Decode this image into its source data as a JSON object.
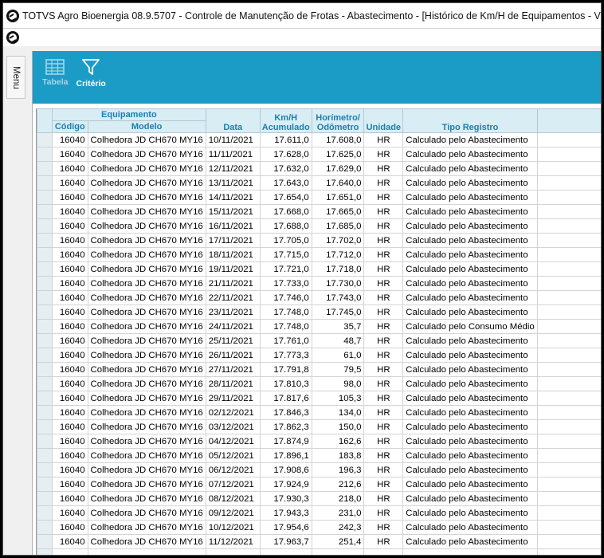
{
  "window": {
    "title": "TOTVS Agro Bioenergia 08.9.5707 - Controle de Manutenção de Frotas - Abastecimento - [Histórico de Km/H de Equipamentos - Vida ]"
  },
  "sidebar": {
    "menu_label": "Menu"
  },
  "ribbon": {
    "tabela_label": "Tabela",
    "criterio_label": "Critério",
    "accent": "#1b9cc7"
  },
  "grid": {
    "group_header": "Equipamento",
    "headers": {
      "codigo": "Código",
      "modelo": "Modelo",
      "data": "Data",
      "km_line1": "Km/H",
      "km_line2": "Acumulado",
      "hor_line1": "Horímetro/",
      "hor_line2": "Odômetro",
      "unidade": "Unidade",
      "tipo": "Tipo Registro"
    },
    "rows": [
      {
        "codigo": "16040",
        "modelo": "Colhedora JD CH670 MY16",
        "data": "10/11/2021",
        "km": "17.611,0",
        "hor": "17.608,0",
        "unidade": "HR",
        "tipo": "Calculado pelo Abastecimento"
      },
      {
        "codigo": "16040",
        "modelo": "Colhedora JD CH670 MY16",
        "data": "11/11/2021",
        "km": "17.628,0",
        "hor": "17.625,0",
        "unidade": "HR",
        "tipo": "Calculado pelo Abastecimento"
      },
      {
        "codigo": "16040",
        "modelo": "Colhedora JD CH670 MY16",
        "data": "12/11/2021",
        "km": "17.632,0",
        "hor": "17.629,0",
        "unidade": "HR",
        "tipo": "Calculado pelo Abastecimento"
      },
      {
        "codigo": "16040",
        "modelo": "Colhedora JD CH670 MY16",
        "data": "13/11/2021",
        "km": "17.643,0",
        "hor": "17.640,0",
        "unidade": "HR",
        "tipo": "Calculado pelo Abastecimento"
      },
      {
        "codigo": "16040",
        "modelo": "Colhedora JD CH670 MY16",
        "data": "14/11/2021",
        "km": "17.654,0",
        "hor": "17.651,0",
        "unidade": "HR",
        "tipo": "Calculado pelo Abastecimento"
      },
      {
        "codigo": "16040",
        "modelo": "Colhedora JD CH670 MY16",
        "data": "15/11/2021",
        "km": "17.668,0",
        "hor": "17.665,0",
        "unidade": "HR",
        "tipo": "Calculado pelo Abastecimento"
      },
      {
        "codigo": "16040",
        "modelo": "Colhedora JD CH670 MY16",
        "data": "16/11/2021",
        "km": "17.688,0",
        "hor": "17.685,0",
        "unidade": "HR",
        "tipo": "Calculado pelo Abastecimento"
      },
      {
        "codigo": "16040",
        "modelo": "Colhedora JD CH670 MY16",
        "data": "17/11/2021",
        "km": "17.705,0",
        "hor": "17.702,0",
        "unidade": "HR",
        "tipo": "Calculado pelo Abastecimento"
      },
      {
        "codigo": "16040",
        "modelo": "Colhedora JD CH670 MY16",
        "data": "18/11/2021",
        "km": "17.715,0",
        "hor": "17.712,0",
        "unidade": "HR",
        "tipo": "Calculado pelo Abastecimento"
      },
      {
        "codigo": "16040",
        "modelo": "Colhedora JD CH670 MY16",
        "data": "19/11/2021",
        "km": "17.721,0",
        "hor": "17.718,0",
        "unidade": "HR",
        "tipo": "Calculado pelo Abastecimento"
      },
      {
        "codigo": "16040",
        "modelo": "Colhedora JD CH670 MY16",
        "data": "21/11/2021",
        "km": "17.733,0",
        "hor": "17.730,0",
        "unidade": "HR",
        "tipo": "Calculado pelo Abastecimento"
      },
      {
        "codigo": "16040",
        "modelo": "Colhedora JD CH670 MY16",
        "data": "22/11/2021",
        "km": "17.746,0",
        "hor": "17.743,0",
        "unidade": "HR",
        "tipo": "Calculado pelo Abastecimento"
      },
      {
        "codigo": "16040",
        "modelo": "Colhedora JD CH670 MY16",
        "data": "23/11/2021",
        "km": "17.748,0",
        "hor": "17.745,0",
        "unidade": "HR",
        "tipo": "Calculado pelo Abastecimento"
      },
      {
        "codigo": "16040",
        "modelo": "Colhedora JD CH670 MY16",
        "data": "24/11/2021",
        "km": "17.748,0",
        "hor": "35,7",
        "unidade": "HR",
        "tipo": "Calculado pelo Consumo Médio"
      },
      {
        "codigo": "16040",
        "modelo": "Colhedora JD CH670 MY16",
        "data": "25/11/2021",
        "km": "17.761,0",
        "hor": "48,7",
        "unidade": "HR",
        "tipo": "Calculado pelo Abastecimento"
      },
      {
        "codigo": "16040",
        "modelo": "Colhedora JD CH670 MY16",
        "data": "26/11/2021",
        "km": "17.773,3",
        "hor": "61,0",
        "unidade": "HR",
        "tipo": "Calculado pelo Abastecimento"
      },
      {
        "codigo": "16040",
        "modelo": "Colhedora JD CH670 MY16",
        "data": "27/11/2021",
        "km": "17.791,8",
        "hor": "79,5",
        "unidade": "HR",
        "tipo": "Calculado pelo Abastecimento"
      },
      {
        "codigo": "16040",
        "modelo": "Colhedora JD CH670 MY16",
        "data": "28/11/2021",
        "km": "17.810,3",
        "hor": "98,0",
        "unidade": "HR",
        "tipo": "Calculado pelo Abastecimento"
      },
      {
        "codigo": "16040",
        "modelo": "Colhedora JD CH670 MY16",
        "data": "29/11/2021",
        "km": "17.817,6",
        "hor": "105,3",
        "unidade": "HR",
        "tipo": "Calculado pelo Abastecimento"
      },
      {
        "codigo": "16040",
        "modelo": "Colhedora JD CH670 MY16",
        "data": "02/12/2021",
        "km": "17.846,3",
        "hor": "134,0",
        "unidade": "HR",
        "tipo": "Calculado pelo Abastecimento"
      },
      {
        "codigo": "16040",
        "modelo": "Colhedora JD CH670 MY16",
        "data": "03/12/2021",
        "km": "17.862,3",
        "hor": "150,0",
        "unidade": "HR",
        "tipo": "Calculado pelo Abastecimento"
      },
      {
        "codigo": "16040",
        "modelo": "Colhedora JD CH670 MY16",
        "data": "04/12/2021",
        "km": "17.874,9",
        "hor": "162,6",
        "unidade": "HR",
        "tipo": "Calculado pelo Abastecimento"
      },
      {
        "codigo": "16040",
        "modelo": "Colhedora JD CH670 MY16",
        "data": "05/12/2021",
        "km": "17.896,1",
        "hor": "183,8",
        "unidade": "HR",
        "tipo": "Calculado pelo Abastecimento"
      },
      {
        "codigo": "16040",
        "modelo": "Colhedora JD CH670 MY16",
        "data": "06/12/2021",
        "km": "17.908,6",
        "hor": "196,3",
        "unidade": "HR",
        "tipo": "Calculado pelo Abastecimento"
      },
      {
        "codigo": "16040",
        "modelo": "Colhedora JD CH670 MY16",
        "data": "07/12/2021",
        "km": "17.924,9",
        "hor": "212,6",
        "unidade": "HR",
        "tipo": "Calculado pelo Abastecimento"
      },
      {
        "codigo": "16040",
        "modelo": "Colhedora JD CH670 MY16",
        "data": "08/12/2021",
        "km": "17.930,3",
        "hor": "218,0",
        "unidade": "HR",
        "tipo": "Calculado pelo Abastecimento"
      },
      {
        "codigo": "16040",
        "modelo": "Colhedora JD CH670 MY16",
        "data": "09/12/2021",
        "km": "17.943,3",
        "hor": "231,0",
        "unidade": "HR",
        "tipo": "Calculado pelo Abastecimento"
      },
      {
        "codigo": "16040",
        "modelo": "Colhedora JD CH670 MY16",
        "data": "10/12/2021",
        "km": "17.954,6",
        "hor": "242,3",
        "unidade": "HR",
        "tipo": "Calculado pelo Abastecimento"
      },
      {
        "codigo": "16040",
        "modelo": "Colhedora JD CH670 MY16",
        "data": "11/12/2021",
        "km": "17.963,7",
        "hor": "251,4",
        "unidade": "HR",
        "tipo": "Calculado pelo Abastecimento"
      }
    ]
  }
}
